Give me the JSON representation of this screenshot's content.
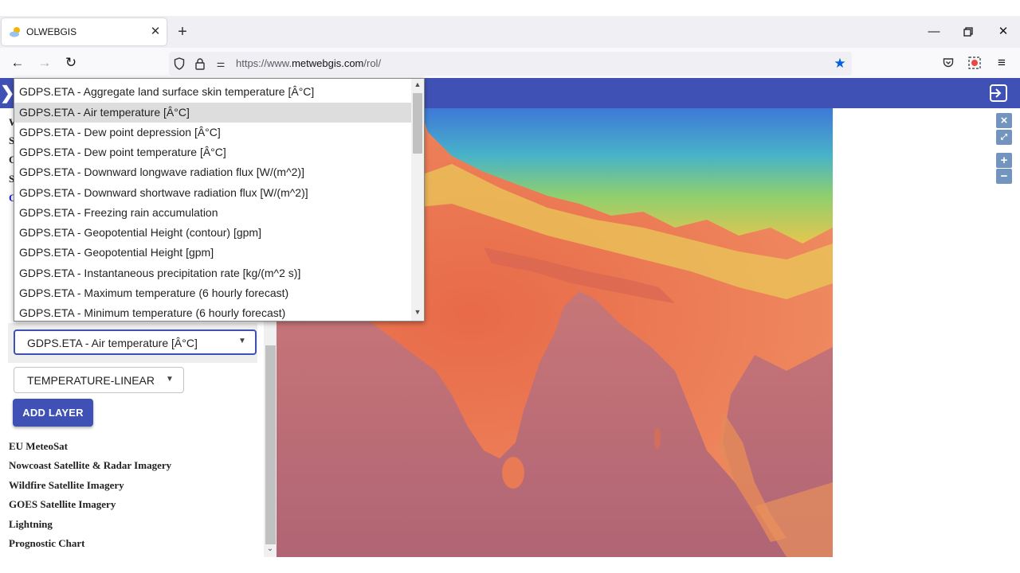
{
  "browser": {
    "tab_title": "OLWEBGIS",
    "url_prefix": "https://www.",
    "url_domain": "metwebgis.com",
    "url_path": "/rol/"
  },
  "sidebar": {
    "partial_letters": [
      "W",
      "S",
      "C",
      "S",
      "C"
    ],
    "layer_select_value": "GDPS.ETA - Air temperature [Â°C]",
    "style_select_value": "TEMPERATURE-LINEAR",
    "add_layer_label": "ADD LAYER",
    "categories": [
      "EU MeteoSat",
      "Nowcoast Satellite & Radar Imagery",
      "Wildfire Satellite Imagery",
      "GOES Satellite Imagery",
      "Lightning",
      "Prognostic Chart"
    ]
  },
  "dropdown": {
    "selected_index": 1,
    "options": [
      "GDPS.ETA - Aggregate land surface skin temperature [Â°C]",
      "GDPS.ETA - Air temperature [Â°C]",
      "GDPS.ETA - Dew point depression [Â°C]",
      "GDPS.ETA - Dew point temperature [Â°C]",
      "GDPS.ETA - Downward longwave radiation flux [W/(m^2)]",
      "GDPS.ETA - Downward shortwave radiation flux [W/(m^2)]",
      "GDPS.ETA - Freezing rain accumulation",
      "GDPS.ETA - Geopotential Height (contour) [gpm]",
      "GDPS.ETA - Geopotential Height [gpm]",
      "GDPS.ETA - Instantaneous precipitation rate [kg/(m^2 s)]",
      "GDPS.ETA - Maximum temperature (6 hourly forecast)",
      "GDPS.ETA - Minimum temperature (6 hourly forecast)"
    ]
  },
  "map_controls": {
    "close": "×",
    "zoom_in": "+",
    "zoom_out": "−"
  },
  "colors": {
    "brand": "#3f51b5",
    "star": "#0060df"
  }
}
